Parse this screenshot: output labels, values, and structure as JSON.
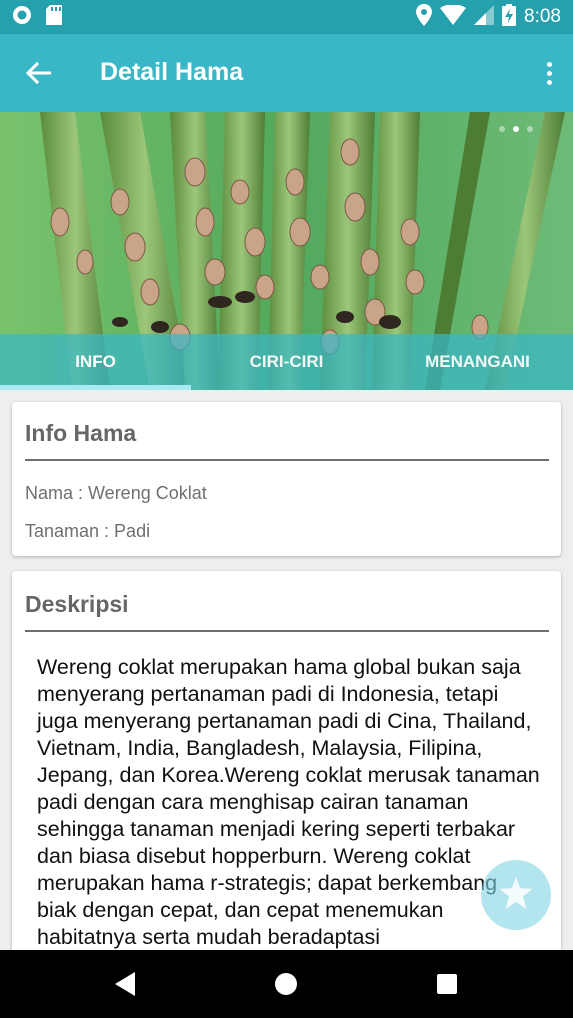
{
  "status_bar": {
    "time": "8:08",
    "icons": [
      "circle-notification-icon",
      "sd-card-icon",
      "location-icon",
      "wifi-icon",
      "signal-icon",
      "battery-charging-icon"
    ]
  },
  "toolbar": {
    "title": "Detail Hama",
    "back_icon": "arrow-back-icon",
    "menu_icon": "more-vert-icon"
  },
  "hero": {
    "image": "photo of brown planthoppers on rice stems",
    "pager_count": 3,
    "pager_active": 1
  },
  "tabs": [
    {
      "label": "INFO",
      "active": true
    },
    {
      "label": "CIRI-CIRI",
      "active": false
    },
    {
      "label": "MENANGANI",
      "active": false
    }
  ],
  "info_card": {
    "title": "Info Hama",
    "nama": "Nama : Wereng Coklat",
    "tanaman": "Tanaman : Padi"
  },
  "description_card": {
    "title": "Deskripsi",
    "text": "Wereng coklat merupakan hama global bukan saja menyerang pertanaman padi di Indonesia, tetapi juga menyerang pertanaman padi di Cina, Thailand, Vietnam, India, Bangladesh, Malaysia, Filipina, Jepang, dan Korea.Wereng coklat merusak tanaman padi dengan cara menghisap cairan tanaman sehingga tanaman menjadi kering seperti terbakar dan biasa disebut hopperburn. Wereng coklat merupakan hama r-strategis; dapat berkembang biak dengan cepat, dan cepat menemukan habitatnya serta mudah beradaptasi"
  },
  "fab": {
    "icon": "star-icon"
  },
  "nav_bar": {
    "icons": [
      "back-triangle-icon",
      "home-circle-icon",
      "recents-square-icon"
    ]
  },
  "colors": {
    "status_bar": "#25a0ad",
    "toolbar": "#39b7c6",
    "tab_indicator": "#a9e9f2",
    "background": "#eeeeee"
  }
}
